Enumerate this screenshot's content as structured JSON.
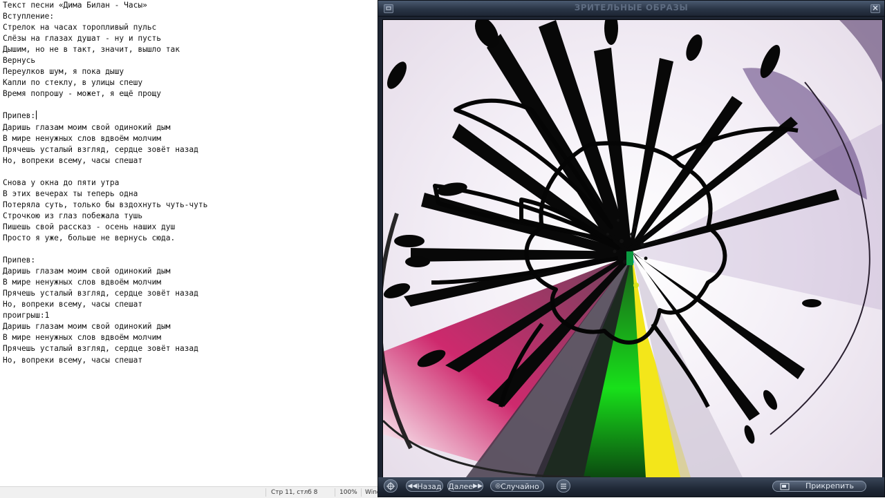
{
  "editor": {
    "lines": [
      "Текст песни «Дима Билан - Часы»",
      "Вступление:",
      "Стрелок на часах торопливый пульс",
      "Слёзы на глазах душат - ну и пусть",
      "Дышим, но не в такт, значит, вышло так",
      "Вернусь",
      "Переулков шум, я пока дышу",
      "Капли по стеклу, в улицы спешу",
      "Время попрошу - может, я ещё прощу",
      "",
      "Припев:",
      "Даришь глазам моим свой одинокий дым",
      "В мире ненужных слов вдвоём молчим",
      "Прячешь усталый взгляд, сердце зовёт назад",
      "Но, вопреки всему, часы спешат",
      "",
      "Снова у окна до пяти утра",
      "В этих вечерах ты теперь одна",
      "Потеряла суть, только бы вздохнуть чуть-чуть",
      "Строчкою из глаз побежала тушь",
      "Пишешь свой рассказ - осень наших душ",
      "Просто я уже, больше не вернусь сюда.",
      "",
      "Припев:",
      "Даришь глазам моим свой одинокий дым",
      "В мире ненужных слов вдвоём молчим",
      "Прячешь усталый взгляд, сердце зовёт назад",
      "Но, вопреки всему, часы спешат",
      "проигрыш:1",
      "Даришь глазам моим свой одинокий дым",
      "В мире ненужных слов вдвоём молчим",
      "Прячешь усталый взгляд, сердце зовёт назад",
      "Но, вопреки всему, часы спешат"
    ],
    "caret_line": 10
  },
  "statusbar": {
    "position": "Стр 11, стлб 8",
    "zoom": "100%",
    "line_ending": "Windows (CRLF)"
  },
  "visualizer": {
    "title": "ЗРИТЕЛЬНЫЕ ОБРАЗЫ",
    "minimize_icon": "minimize-icon",
    "close_icon": "close-icon",
    "toolbar": {
      "back_label": "Назад",
      "next_label": "Далее",
      "random_label": "Случайно",
      "pin_label": "Прикрепить"
    }
  }
}
